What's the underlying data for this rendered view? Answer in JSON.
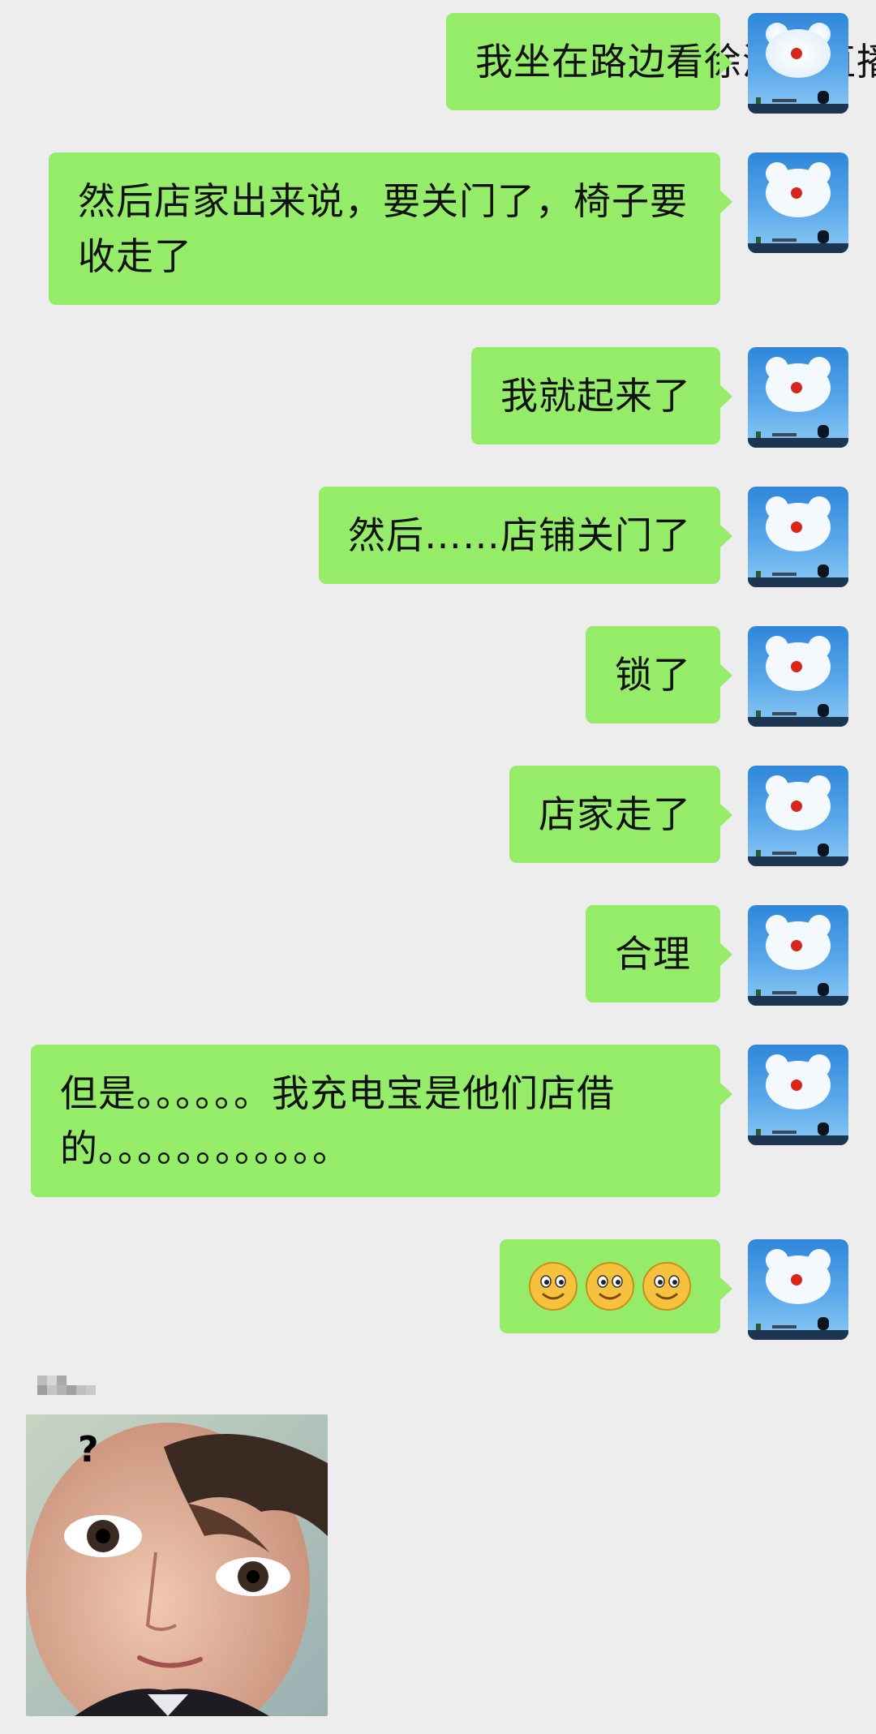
{
  "messages": [
    {
      "text": "我坐在路边看徐泽辉直播"
    },
    {
      "text": "然后店家出来说，要关门了，椅子要收走了"
    },
    {
      "text": "我就起来了"
    },
    {
      "text": "然后……店铺关门了"
    },
    {
      "text": "锁了"
    },
    {
      "text": "店家走了"
    },
    {
      "text": "合理"
    },
    {
      "text": "但是。。。。。。我充电宝是他们店借的。。。。。。。。。。。。"
    },
    {
      "emoji": [
        "smile-emoji",
        "smile-emoji",
        "smile-emoji"
      ]
    }
  ],
  "incoming": {
    "photo_overlay_text": "?"
  },
  "colors": {
    "background": "#ededed",
    "bubble_sent": "#95ec69",
    "avatar_sky": "#4a9be3"
  }
}
